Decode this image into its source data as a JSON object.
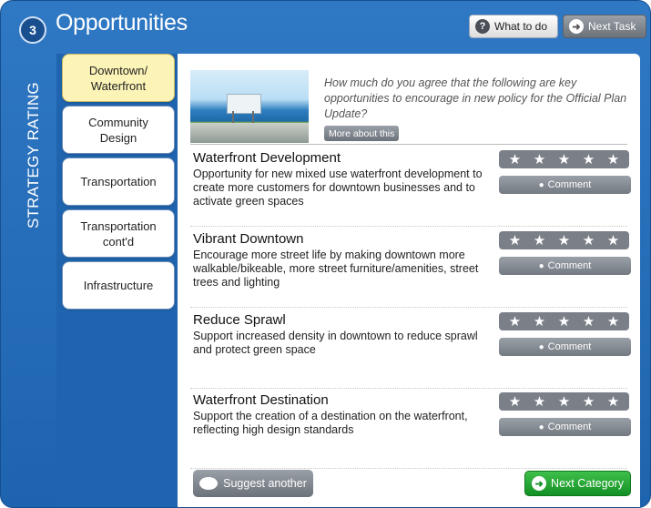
{
  "header": {
    "step_number": "3",
    "title": "Opportunities",
    "what_to_do_label": "What to do",
    "next_task_label": "Next Task"
  },
  "sidebar_label": "STRATEGY RATING",
  "tabs": [
    {
      "label_line1": "Downtown/",
      "label_line2": "Waterfront",
      "active": true
    },
    {
      "label_line1": "Community",
      "label_line2": "Design",
      "active": false
    },
    {
      "label_line1": "Transportation",
      "label_line2": "",
      "active": false
    },
    {
      "label_line1": "Transportation",
      "label_line2": "cont'd",
      "active": false
    },
    {
      "label_line1": "Infrastructure",
      "label_line2": "",
      "active": false
    }
  ],
  "intro": {
    "question": "How much do you agree that the following are key opportunities to encourage in new policy for the Official Plan Update?",
    "more_label": "More about this"
  },
  "items": [
    {
      "title": "Waterfront Development",
      "description": "Opportunity for new mixed use waterfront development to create more customers for downtown businesses and to activate green spaces",
      "rating": 0,
      "comment_label": "Comment"
    },
    {
      "title": "Vibrant Downtown",
      "description": "Encourage more street life by making downtown more walkable/bikeable, more street furniture/amenities, street trees and lighting",
      "rating": 0,
      "comment_label": "Comment"
    },
    {
      "title": "Reduce Sprawl",
      "description": "Support increased density in downtown to reduce sprawl and protect green space",
      "rating": 0,
      "comment_label": "Comment"
    },
    {
      "title": "Waterfront Destination",
      "description": "Support the creation of a destination on the waterfront, reflecting high design standards",
      "rating": 0,
      "comment_label": "Comment"
    }
  ],
  "footer": {
    "suggest_label": "Suggest another",
    "next_category_label": "Next Category"
  },
  "icons": {
    "question": "?",
    "arrow": "➜",
    "star": "★",
    "bubble": "●"
  },
  "colors": {
    "frame_blue": "#2f78c4",
    "active_tab": "#fcf4b6",
    "next_category_green": "#139024"
  }
}
